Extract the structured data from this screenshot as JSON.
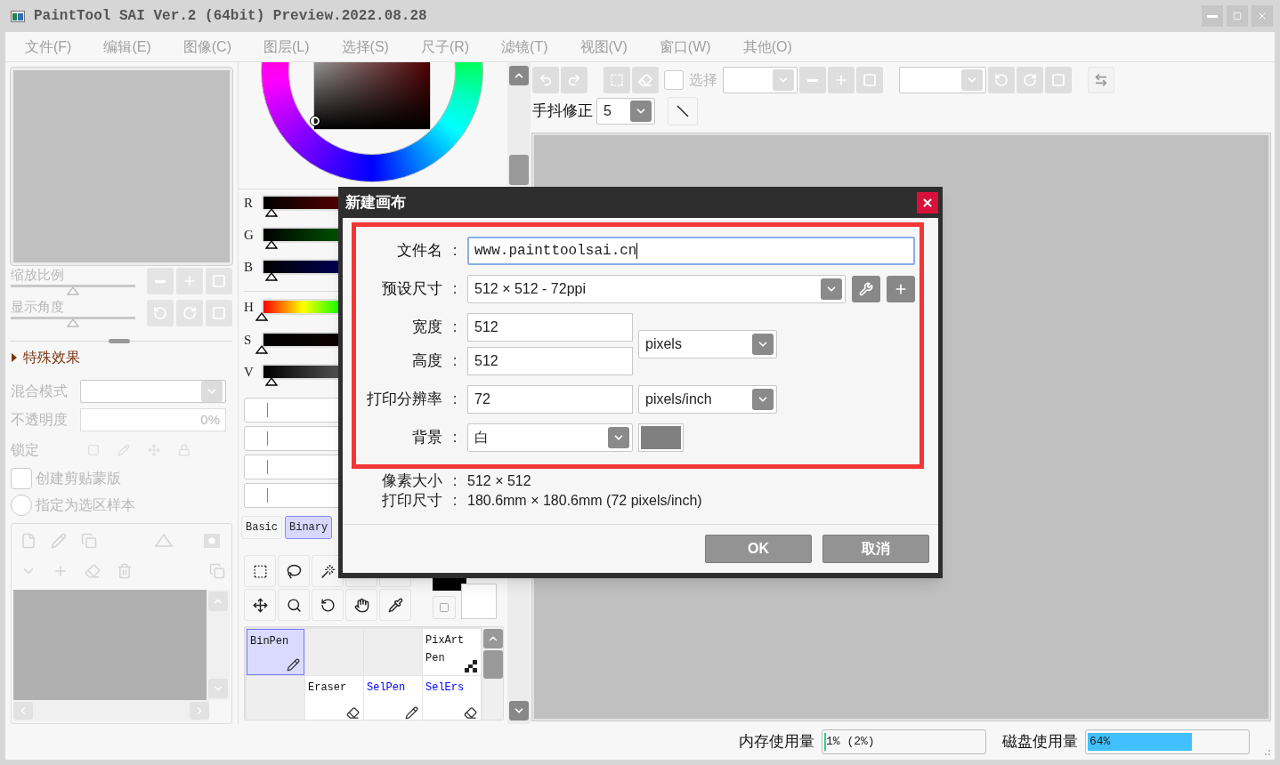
{
  "window": {
    "title": "PaintTool SAI Ver.2 (64bit) Preview.2022.08.28"
  },
  "menu": [
    "文件(F)",
    "编辑(E)",
    "图像(C)",
    "图层(L)",
    "选择(S)",
    "尺子(R)",
    "滤镜(T)",
    "视图(V)",
    "窗口(W)",
    "其他(O)"
  ],
  "navigator": {
    "sliders": [
      {
        "label": "缩放比例",
        "level": 0.5
      },
      {
        "label": "显示角度",
        "level": 0.5
      }
    ]
  },
  "effects": {
    "label": "特殊效果",
    "expanded": false
  },
  "layer_props": {
    "disabled": true,
    "blend_label": "混合模式",
    "opacity_label": "不透明度",
    "opacity_value": "0%",
    "lock_label": "锁定",
    "clip": {
      "label": "创建剪贴蒙版",
      "checked": false
    },
    "sample": {
      "label": "指定为选区样本",
      "selected": false
    }
  },
  "color_sliders": [
    {
      "label": "R",
      "kind": "red",
      "level": 0.04
    },
    {
      "label": "G",
      "kind": "green",
      "level": 0.04
    },
    {
      "label": "B",
      "kind": "blue",
      "level": 0.04
    },
    {
      "label": "H",
      "kind": "hue",
      "level": 0.0
    },
    {
      "label": "S",
      "kind": "saturation",
      "level": 0.0
    },
    {
      "label": "V",
      "kind": "value",
      "level": 0.04
    }
  ],
  "tool_tabs": [
    {
      "label": "Basic",
      "selected": false
    },
    {
      "label": "Binary",
      "selected": true
    }
  ],
  "brushes": [
    {
      "kind": "pen",
      "label": "BinPen",
      "selected": true
    },
    {
      "kind": "empty",
      "selected": false
    },
    {
      "kind": "empty",
      "selected": false
    },
    {
      "kind": "pixel",
      "label": "PixArt Pen",
      "selected": false
    },
    {
      "kind": "empty",
      "selected": false
    },
    {
      "kind": "eraser",
      "label": "Eraser",
      "selected": false
    },
    {
      "kind": "selpen",
      "label": "SelPen",
      "selected": false
    },
    {
      "kind": "selers",
      "label": "SelErs",
      "selected": false
    }
  ],
  "toolbar": {
    "select_label": "选择",
    "select_checked": false,
    "stabilizer_label": "手抖修正",
    "stabilizer_value": "5"
  },
  "status": [
    {
      "label": "内存使用量",
      "reading": "1% (2%)",
      "level": 0.01,
      "color": "#30d080"
    },
    {
      "label": "磁盘使用量",
      "reading": "64%",
      "level": 0.64,
      "color": "#40c0ff"
    }
  ],
  "dialog": {
    "title": "新建画布",
    "filename": {
      "label": "文件名",
      "colon": ":",
      "value": "www.painttoolsai.cn"
    },
    "preset": {
      "label": "预设尺寸",
      "colon": ":",
      "value": "512 × 512 - 72ppi"
    },
    "width": {
      "label": "宽度",
      "colon": ":",
      "value": "512"
    },
    "height": {
      "label": "高度",
      "colon": ":",
      "value": "512"
    },
    "size_unit": "pixels",
    "resolution": {
      "label": "打印分辨率",
      "colon": ":",
      "value": "72",
      "unit": "pixels/inch"
    },
    "background": {
      "label": "背景",
      "colon": ":",
      "value": "白"
    },
    "info": [
      {
        "label": "像素大小",
        "colon": ":",
        "value": "512 × 512"
      },
      {
        "label": "打印尺寸",
        "colon": ":",
        "value": "180.6mm × 180.6mm (72 pixels/inch)"
      }
    ],
    "buttons": [
      "OK",
      "取消"
    ]
  }
}
